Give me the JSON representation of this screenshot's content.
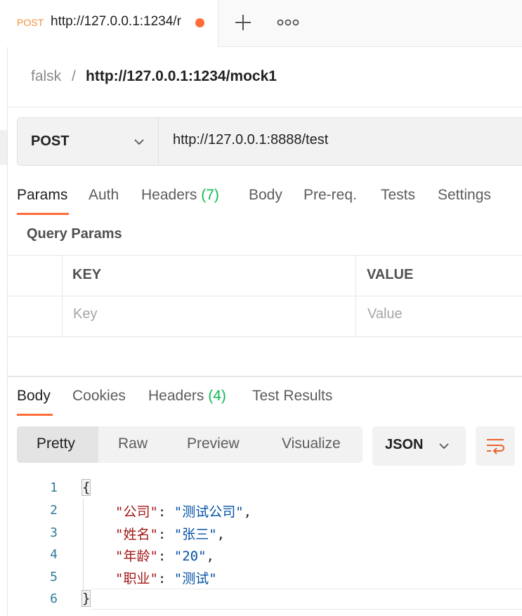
{
  "tab": {
    "method": "POST",
    "url": "http://127.0.0.1:1234/r",
    "unsaved_dot_color": "#ff6c37",
    "new_tab_icon": "plus-icon",
    "more_icon": "more-horizontal-icon"
  },
  "breadcrumb": {
    "parent": "falsk",
    "separator": "/",
    "current": "http://127.0.0.1:1234/mock1"
  },
  "request": {
    "method": "POST",
    "url": "http://127.0.0.1:8888/test"
  },
  "request_tabs": [
    {
      "label": "Params",
      "active": true
    },
    {
      "label": "Auth"
    },
    {
      "label": "Headers",
      "count": "(7)"
    },
    {
      "label": "Body"
    },
    {
      "label": "Pre-req."
    },
    {
      "label": "Tests"
    },
    {
      "label": "Settings"
    }
  ],
  "query_params": {
    "title": "Query Params",
    "columns": [
      "KEY",
      "VALUE"
    ],
    "key_placeholder": "Key",
    "value_placeholder": "Value"
  },
  "response_tabs": [
    {
      "label": "Body",
      "active": true
    },
    {
      "label": "Cookies"
    },
    {
      "label": "Headers",
      "count": "(4)"
    },
    {
      "label": "Test Results"
    }
  ],
  "view_modes": [
    {
      "label": "Pretty",
      "active": true
    },
    {
      "label": "Raw"
    },
    {
      "label": "Preview"
    },
    {
      "label": "Visualize"
    }
  ],
  "format": "JSON",
  "wrap_icon": "wrap-lines-icon",
  "code": {
    "line_numbers": [
      "1",
      "2",
      "3",
      "4",
      "5",
      "6"
    ],
    "open": "{",
    "close": "}",
    "fields": [
      {
        "key": "\"公司\"",
        "value": "\"测试公司\"",
        "sep": ": ",
        "end": ","
      },
      {
        "key": "\"姓名\"",
        "value": "\"张三\"",
        "sep": ": ",
        "end": ","
      },
      {
        "key": "\"年龄\"",
        "value": "\"20\"",
        "sep": ": ",
        "end": ","
      },
      {
        "key": "\"职业\"",
        "value": "\"测试\"",
        "sep": ": ",
        "end": ""
      }
    ]
  },
  "colors": {
    "accent": "#ff6c37",
    "count_green": "#0cbb52",
    "json_key": "#a31515",
    "json_string": "#0451a5",
    "line_number": "#2d7d9a"
  }
}
